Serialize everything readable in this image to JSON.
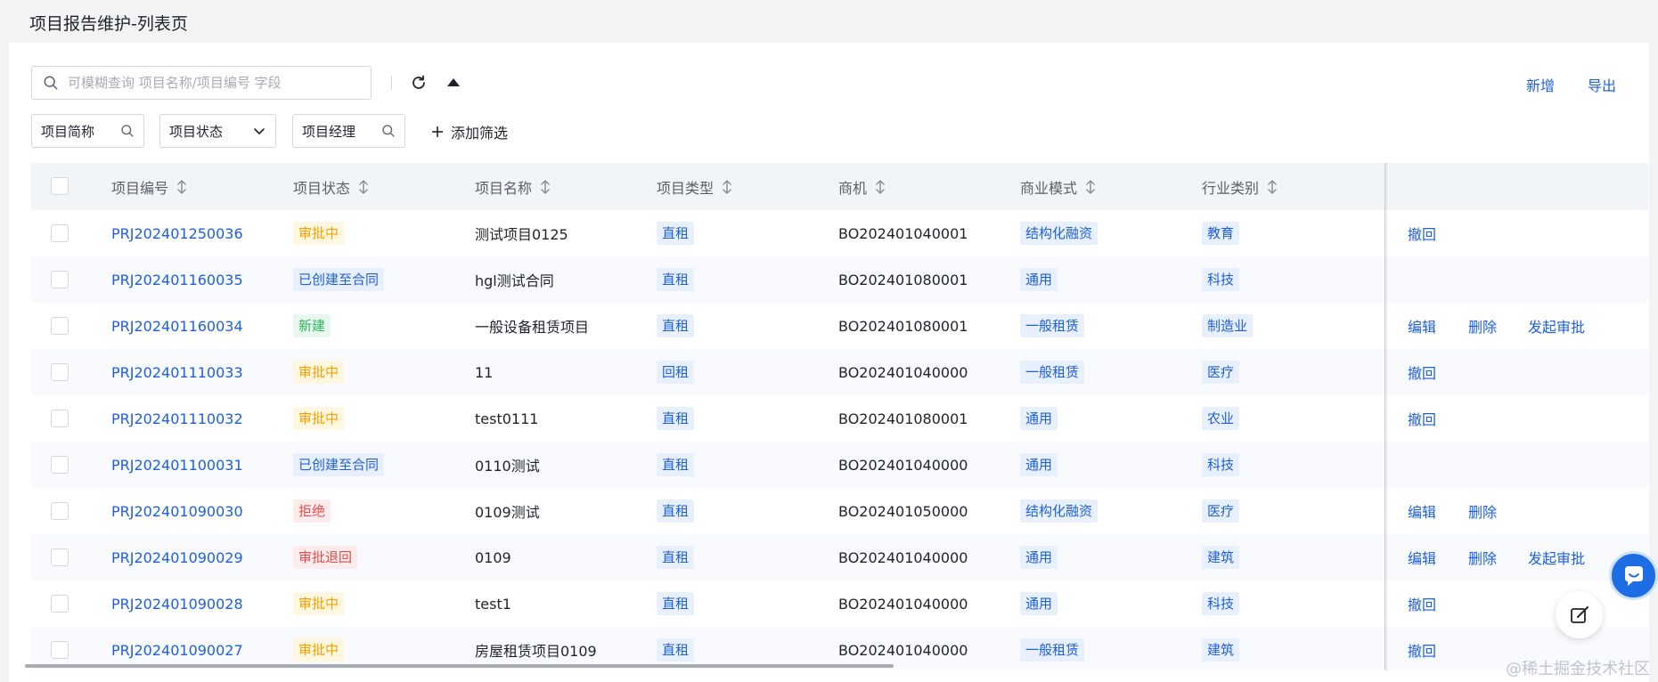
{
  "page_title": "项目报告维护-列表页",
  "search": {
    "placeholder": "可模糊查询 项目名称/项目编号 字段",
    "value": ""
  },
  "toolbar": {
    "add_label": "新增",
    "export_label": "导出"
  },
  "filters": [
    {
      "label": "项目简称",
      "icon": "search-icon"
    },
    {
      "label": "项目状态",
      "icon": "chevron-down-icon"
    },
    {
      "label": "项目经理",
      "icon": "search-icon"
    }
  ],
  "add_filter_label": "添加筛选",
  "columns": [
    "项目编号",
    "项目状态",
    "项目名称",
    "项目类型",
    "商机",
    "商业模式",
    "行业类别"
  ],
  "status_colors": {
    "审批中": {
      "bg": "#fff7e0",
      "fg": "#f5a000"
    },
    "已创建至合同": {
      "bg": "#e8f0fd",
      "fg": "#1d5fe0"
    },
    "新建": {
      "bg": "#e8f8ee",
      "fg": "#2fb45f"
    },
    "拒绝": {
      "bg": "#fdecec",
      "fg": "#e24c4c"
    },
    "审批退回": {
      "bg": "#fdecec",
      "fg": "#e24c4c"
    }
  },
  "rows": [
    {
      "code": "PRJ202401250036",
      "status": "审批中",
      "name": "测试项目0125",
      "type": "直租",
      "opp": "BO202401040001",
      "mode": "结构化融资",
      "industry": "教育",
      "actions": [
        "撤回"
      ]
    },
    {
      "code": "PRJ202401160035",
      "status": "已创建至合同",
      "name": "hgl测试合同",
      "type": "直租",
      "opp": "BO202401080001",
      "mode": "通用",
      "industry": "科技",
      "actions": []
    },
    {
      "code": "PRJ202401160034",
      "status": "新建",
      "name": "一般设备租赁项目",
      "type": "直租",
      "opp": "BO202401080001",
      "mode": "一般租赁",
      "industry": "制造业",
      "actions": [
        "编辑",
        "删除",
        "发起审批"
      ]
    },
    {
      "code": "PRJ202401110033",
      "status": "审批中",
      "name": "11",
      "type": "回租",
      "opp": "BO202401040000",
      "mode": "一般租赁",
      "industry": "医疗",
      "actions": [
        "撤回"
      ]
    },
    {
      "code": "PRJ202401110032",
      "status": "审批中",
      "name": "test0111",
      "type": "直租",
      "opp": "BO202401080001",
      "mode": "通用",
      "industry": "农业",
      "actions": [
        "撤回"
      ]
    },
    {
      "code": "PRJ202401100031",
      "status": "已创建至合同",
      "name": "0110测试",
      "type": "直租",
      "opp": "BO202401040000",
      "mode": "通用",
      "industry": "科技",
      "actions": []
    },
    {
      "code": "PRJ202401090030",
      "status": "拒绝",
      "name": "0109测试",
      "type": "直租",
      "opp": "BO202401050000",
      "mode": "结构化融资",
      "industry": "医疗",
      "actions": [
        "编辑",
        "删除"
      ]
    },
    {
      "code": "PRJ202401090029",
      "status": "审批退回",
      "name": "0109",
      "type": "直租",
      "opp": "BO202401040000",
      "mode": "通用",
      "industry": "建筑",
      "actions": [
        "编辑",
        "删除",
        "发起审批"
      ]
    },
    {
      "code": "PRJ202401090028",
      "status": "审批中",
      "name": "test1",
      "type": "直租",
      "opp": "BO202401040000",
      "mode": "通用",
      "industry": "科技",
      "actions": [
        "撤回"
      ]
    },
    {
      "code": "PRJ202401090027",
      "status": "审批中",
      "name": "房屋租赁项目0109",
      "type": "直租",
      "opp": "BO202401040000",
      "mode": "一般租赁",
      "industry": "建筑",
      "actions": [
        "撤回"
      ]
    }
  ],
  "watermark": "@稀土掘金技术社区"
}
